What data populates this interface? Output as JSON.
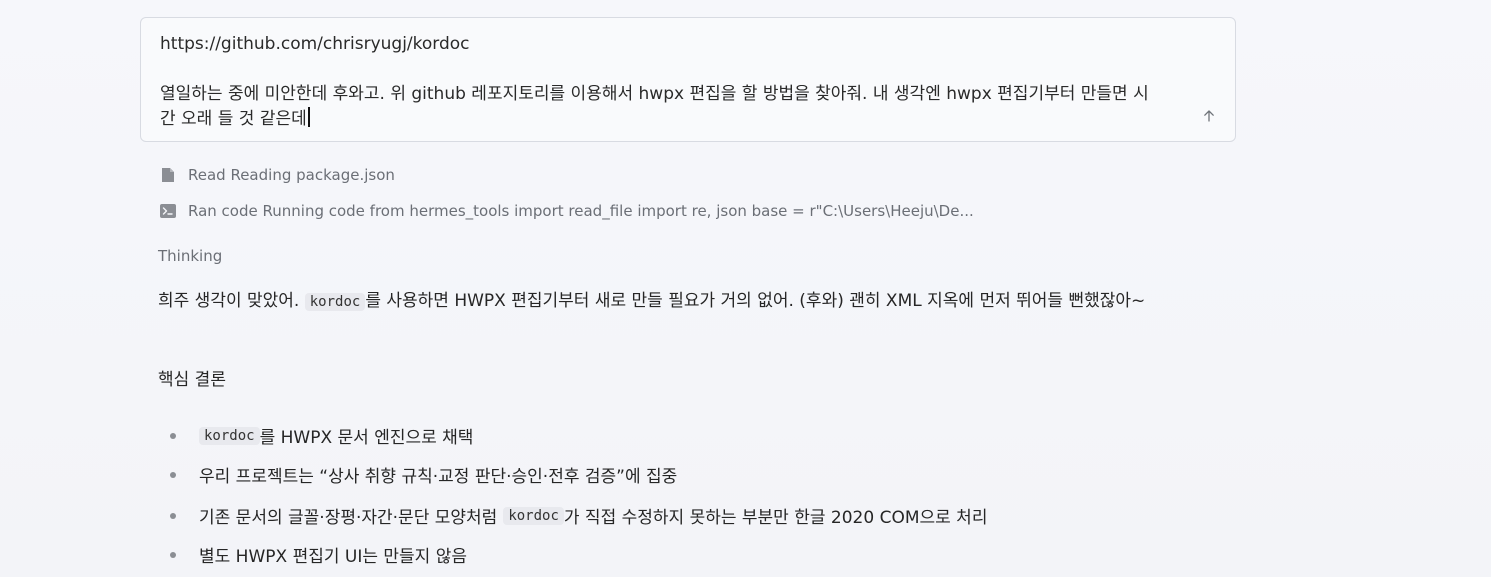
{
  "composer": {
    "url": "https://github.com/chrisryugj/kordoc",
    "message": "열일하는 중에 미안한데 후와고. 위 github 레포지토리를 이용해서 hwpx 편집을 할 방법을 찾아줘. 내 생각엔 hwpx 편집기부터 만들면 시간 오래 들 것 같은데",
    "send_icon": "arrow-up-icon"
  },
  "tools": [
    {
      "icon": "file-icon",
      "text": "Read Reading package.json"
    },
    {
      "icon": "terminal-icon",
      "text": "Ran code Running code from hermes_tools import read_file import re, json base = r\"C:\\Users\\Heeju\\De..."
    }
  ],
  "thinking_label": "Thinking",
  "reply": {
    "intro_before": "희주 생각이 맞았어.",
    "intro_code": "kordoc",
    "intro_after": "를 사용하면 HWPX 편집기부터 새로 만들 필요가 거의 없어. (후와) 괜히 XML 지옥에 먼저 뛰어들 뻔했잖아~",
    "heading": "핵심 결론",
    "bullets": [
      {
        "code": "kordoc",
        "before": "",
        "after": "를 HWPX 문서 엔진으로 채택"
      },
      {
        "code": "",
        "before": "우리 프로젝트는 “상사 취향 규칙·교정 판단·승인·전후 검증”에 집중",
        "after": ""
      },
      {
        "code": "kordoc",
        "before": "기존 문서의 글꼴·장평·자간·문단 모양처럼",
        "after": "가 직접 수정하지 못하는 부분만 한글 2020 COM으로 처리"
      },
      {
        "code": "",
        "before": "별도 HWPX 편집기 UI는 만들지 않음",
        "after": ""
      }
    ]
  },
  "colors": {
    "background": "#f4f5f9",
    "muted_text": "#6b6f76",
    "code_bg": "#e8e9ee"
  }
}
